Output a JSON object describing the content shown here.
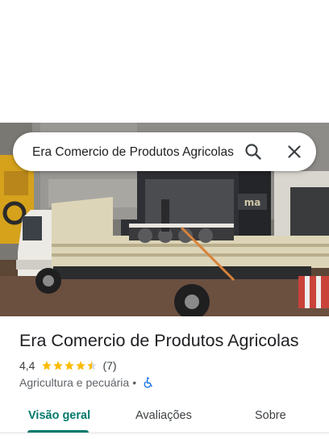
{
  "search": {
    "query": "Era Comercio de Produtos Agricolas",
    "search_icon": "search-icon",
    "close_icon": "close-icon"
  },
  "place": {
    "name": "Era Comercio de Produtos Agricolas",
    "rating_text": "4,4",
    "rating": 4.4,
    "max_rating": 5,
    "review_count": "(7)",
    "category": "Agricultura e pecuária",
    "separator": "•",
    "accessibility_icon": "wheelchair-icon"
  },
  "photo": {
    "store_sign": "ma"
  },
  "tabs": [
    {
      "label": "Visão geral",
      "active": true
    },
    {
      "label": "Avaliações",
      "active": false
    },
    {
      "label": "Sobre",
      "active": false
    }
  ],
  "colors": {
    "accent": "#00796b",
    "star": "#fbbc04",
    "accessibility": "#1a73e8"
  }
}
